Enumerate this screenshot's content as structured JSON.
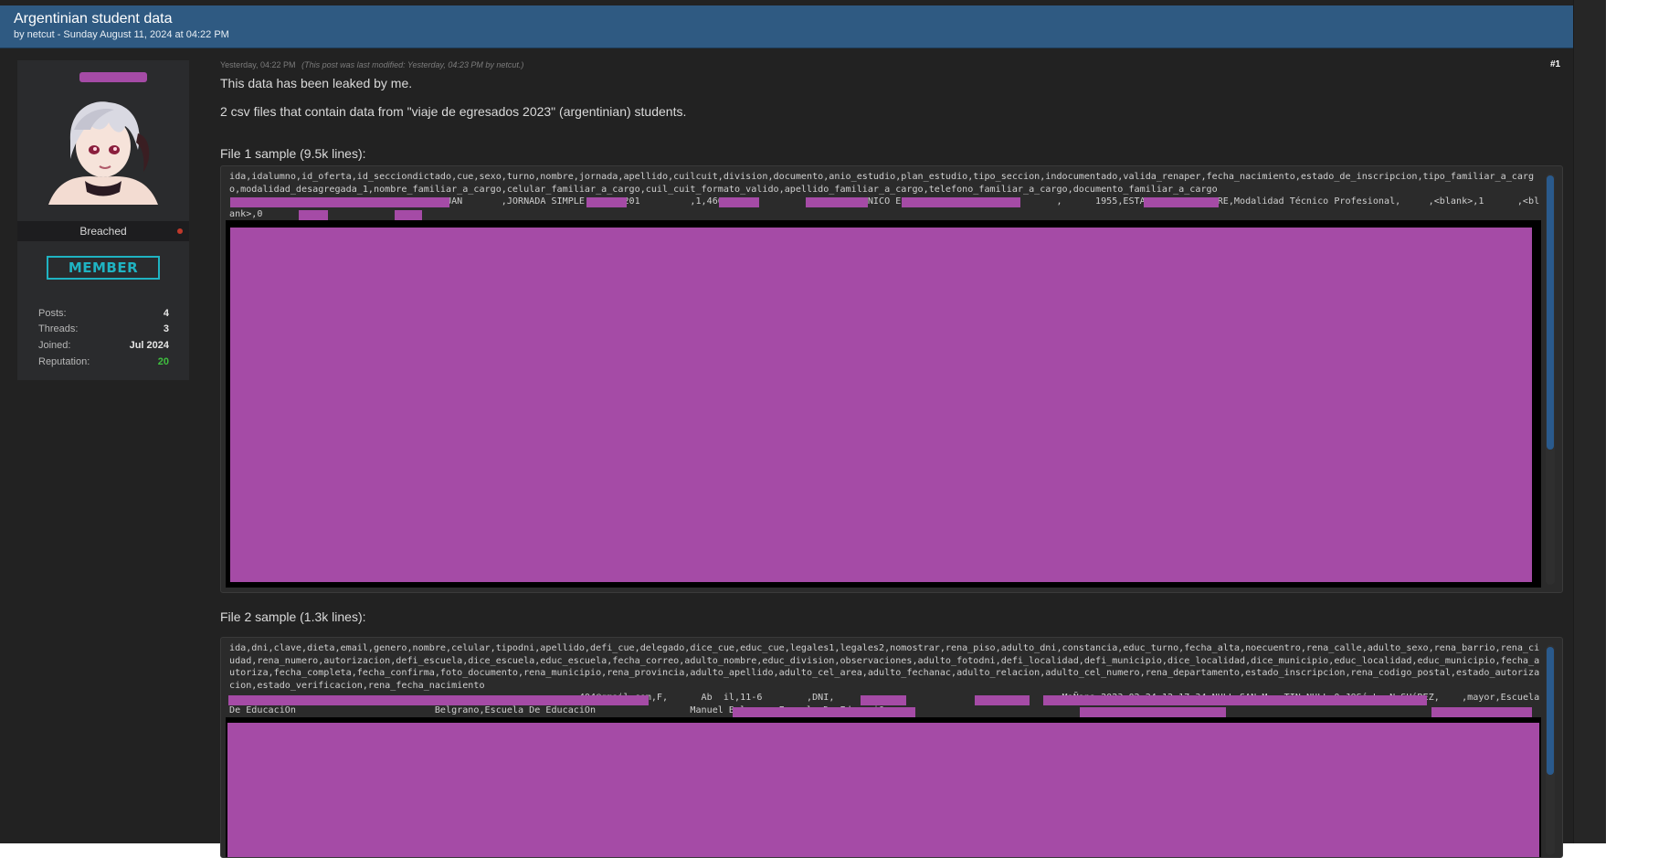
{
  "thread": {
    "title": "Argentinian student data",
    "byline": "by netcut - Sunday August 11, 2024 at 04:22 PM"
  },
  "user": {
    "usertitle": "Breached",
    "rank": "MEMBER",
    "stats": [
      {
        "label": "Posts:",
        "value": "4"
      },
      {
        "label": "Threads:",
        "value": "3"
      },
      {
        "label": "Joined:",
        "value": "Jul 2024"
      },
      {
        "label": "Reputation:",
        "value": "20",
        "color": "#3fbf3f"
      }
    ]
  },
  "post": {
    "date": "Yesterday, 04:22 PM",
    "modified": "(This post was last modified: Yesterday, 04:23 PM by netcut.)",
    "number": "#1",
    "line1": "This data has been leaked by me.",
    "line2": "2 csv files that contain data from \"viaje de egresados 2023\" (argentinian) students.",
    "file1_label": "File 1 sample (9.5k lines):",
    "file1_code": "ida,idalumno,id_oferta,id_secciondictado,cue,sexo,turno,nombre,jornada,apellido,cuilcuit,division,documento,anio_estudio,plan_estudio,tipo_seccion,indocumentado,valida_renaper,fecha_nacimiento,estado_de_inscripcion,tipo_familiar_a_cargo,modalidad_desagregada_1,nombre_familiar_a_cargo,celular_familiar_a_cargo,cuil_cuit_formato_valido,apellido_familiar_a_cargo,telefono_familiar_a_cargo,documento_familiar_a_cargo\n                   ,DOBLE ESCOLARIDAD,JUAN       ,JORNADA SIMPLE,     ,201         ,1,460                    T\\x90CNICO EN ELECTROMECANICA,          ,      1955,ESTADO_ACTIVO,PADRE,Modalidad Técnico Profesional,     ,<blank>,1      ,<blank>,0",
    "file2_label": "File 2 sample (1.3k lines):",
    "file2_code": "ida,dni,clave,dieta,email,genero,nombre,celular,tipodni,apellido,defi_cue,delegado,dice_cue,educ_cue,legales1,legales2,nomostrar,rena_piso,adulto_dni,constancia,educ_turno,fecha_alta,noecuentro,rena_calle,adulto_sexo,rena_barrio,rena_ciudad,rena_numero,autorizacion,defi_escuela,dice_escuela,educ_escuela,fecha_correo,adulto_nombre,educ_division,observaciones,adulto_fotodni,defi_localidad,defi_municipio,dice_localidad,dice_municipio,educ_localidad,educ_municipio,fecha_autoriza,fecha_completa,fecha_confirma,foto_documento,rena_municipio,rena_provincia,adulto_apellido,adulto_cel_area,adulto_fechanac,adulto_relacion,adulto_cel_numero,rena_departamento,estado_inscripcion,rena_codigo_postal,estado_autorizacion,estado_verificacion,rena_fecha_nacimiento\n                                                               404@gmail.com,F,      Ab  il,11-6        ,DNI,                                         MaÑana,2023-02-24 12:17:34,NULL,SAN M   TIN,NULL,0,JOSé L  N SUáREZ,    ,mayor,Escuela De EducaciÓn                         Belgrano,Escuela De EducaciÓn                 Manuel Belgrano,Escuela De EducaciÓn"
  },
  "colors": {
    "header_bg": "#2f5a82",
    "redaction": "#a54ba6",
    "member_badge": "#1fb3c2",
    "reputation": "#3fbf3f"
  },
  "icons": [
    "avatar-image",
    "online-status-dot"
  ]
}
